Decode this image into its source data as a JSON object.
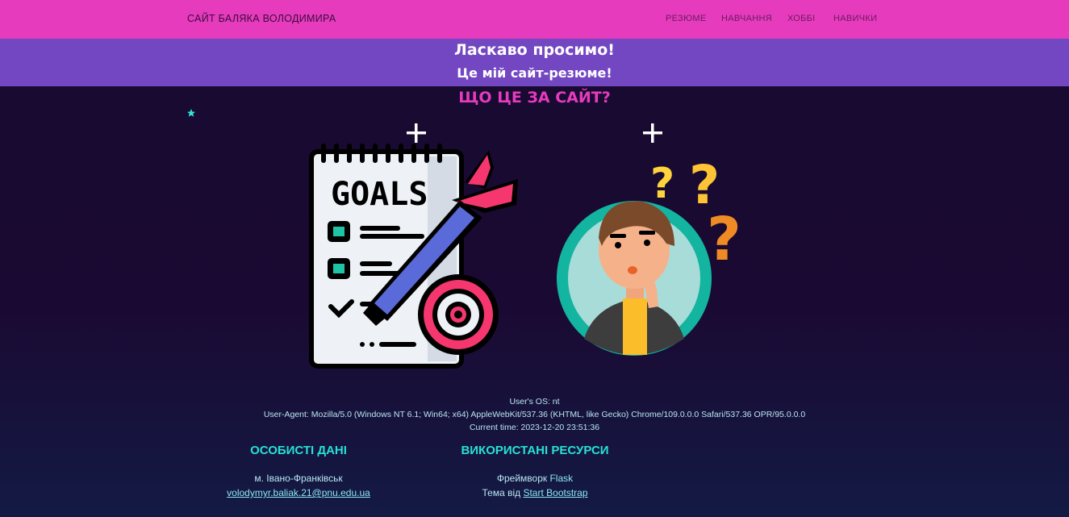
{
  "navbar": {
    "brand": "САЙТ БАЛЯКА ВОЛОДИМИРА",
    "links": [
      "РЕЗЮМЕ",
      "НАВЧАННЯ",
      "ХОББІ",
      "НАВИЧКИ"
    ],
    "color": "#e63bbd"
  },
  "banner": {
    "title": "Ласкаво просимо!",
    "subtitle": "Це мій сайт-резюме!",
    "color": "#7346c2"
  },
  "main": {
    "heading": "ЩО ЦЕ ЗА САЙТ?",
    "goals_word": "GOALS",
    "icons": [
      "star-icon",
      "plus-icon",
      "goals-illustration",
      "thinking-person-illustration"
    ]
  },
  "system_info": {
    "os": "User's OS: nt",
    "user_agent": "User-Agent: Mozilla/5.0 (Windows NT 6.1; Win64; x64) AppleWebKit/537.36 (KHTML, like Gecko) Chrome/109.0.0.0 Safari/537.36 OPR/95.0.0.0",
    "time": "Current time: 2023-12-20 23:51:36"
  },
  "personal": {
    "title": "ОСОБИСТІ ДАНІ",
    "city": "м. Івано-Франківськ",
    "email": "volodymyr.baliak.21@pnu.edu.ua"
  },
  "resources": {
    "title": "ВИКОРИСТАНІ РЕСУРСИ",
    "framework_prefix": "Фреймворк",
    "framework": "Flask",
    "theme_prefix": "Тема від",
    "theme_link": "Start Bootstrap"
  }
}
